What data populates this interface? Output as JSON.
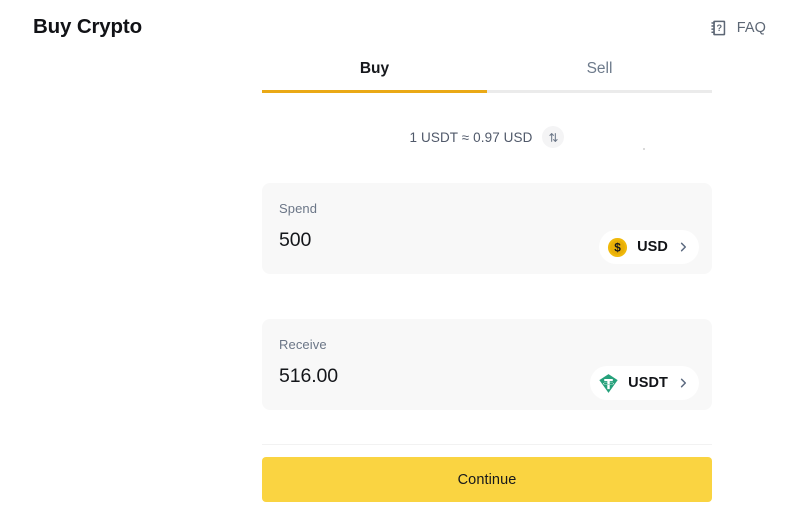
{
  "header": {
    "title": "Buy Crypto",
    "faq_label": "FAQ",
    "faq_icon": "manual-question-icon"
  },
  "tabs": [
    {
      "label": "Buy",
      "active": true
    },
    {
      "label": "Sell",
      "active": false
    }
  ],
  "rate": {
    "text": "1 USDT ≈ 0.97 USD",
    "swap_icon": "swap-vertical-icon"
  },
  "spend": {
    "label": "Spend",
    "value": "500",
    "currency": "USD",
    "currency_icon": "usd-coin-icon",
    "chevron_icon": "chevron-right-icon"
  },
  "receive": {
    "label": "Receive",
    "value": "516.00",
    "currency": "USDT",
    "currency_icon": "tether-icon",
    "chevron_icon": "chevron-right-icon"
  },
  "footer": {
    "continue_label": "Continue"
  },
  "colors": {
    "accent_yellow": "#fad441",
    "tab_underline": "#eaa916",
    "usd_coin": "#f0b90b",
    "tether_green": "#26a17b",
    "card_bg": "#f8f8f8",
    "text_primary": "#16181c",
    "text_muted": "#6b7687"
  }
}
